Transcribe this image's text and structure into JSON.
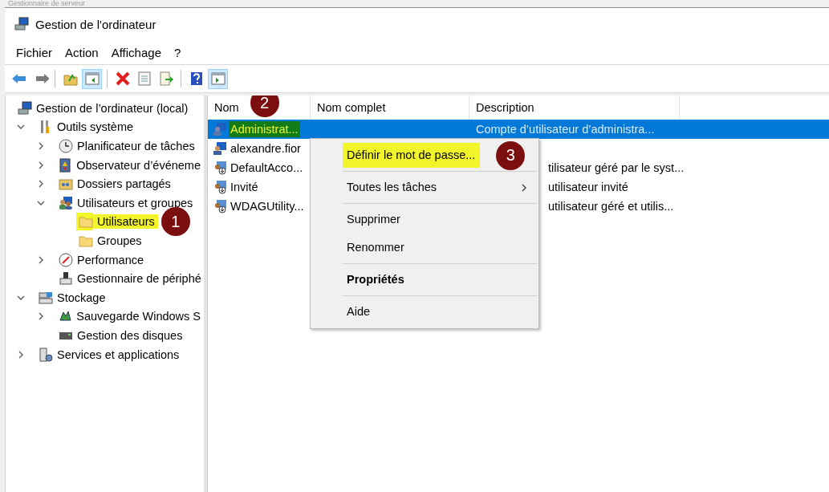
{
  "background_title": "Gestionnaire de serveur",
  "window": {
    "title": "Gestion de l'ordinateur"
  },
  "menu_bar": [
    "Fichier",
    "Action",
    "Affichage",
    "?"
  ],
  "toolbar": [
    {
      "kind": "back",
      "pressed": false
    },
    {
      "kind": "forward",
      "pressed": false
    },
    {
      "kind": "separator"
    },
    {
      "kind": "up",
      "pressed": false
    },
    {
      "kind": "tree",
      "pressed": true
    },
    {
      "kind": "separator"
    },
    {
      "kind": "delete",
      "pressed": false
    },
    {
      "kind": "properties",
      "pressed": false
    },
    {
      "kind": "export",
      "pressed": false
    },
    {
      "kind": "separator"
    },
    {
      "kind": "help",
      "pressed": false
    },
    {
      "kind": "actionpane",
      "pressed": true
    }
  ],
  "tree": [
    {
      "label": "Gestion de l’ordinateur (local)",
      "kind": "computer",
      "highlighted": false,
      "children": [
        {
          "label": "Outils système",
          "kind": "tools",
          "expanded": true,
          "highlighted": false,
          "children": [
            {
              "label": "Planificateur de tâches",
              "kind": "clock",
              "expanded": false,
              "highlighted": false
            },
            {
              "label": "Observateur d’événeme",
              "kind": "log",
              "expanded": false,
              "highlighted": false
            },
            {
              "label": "Dossiers partagés",
              "kind": "share",
              "expanded": false,
              "highlighted": false
            },
            {
              "label": "Utilisateurs et groupes",
              "kind": "users",
              "expanded": true,
              "highlighted": false,
              "children": [
                {
                  "label": "Utilisateurs",
                  "kind": "folder",
                  "highlighted": true,
                  "badge": "1"
                },
                {
                  "label": "Groupes",
                  "kind": "folder",
                  "highlighted": false
                }
              ]
            },
            {
              "label": "Performance",
              "kind": "gauge",
              "expanded": false,
              "highlighted": false
            },
            {
              "label": "Gestionnaire de périphé",
              "kind": "device",
              "highlighted": false
            }
          ]
        },
        {
          "label": "Stockage",
          "kind": "storage",
          "expanded": true,
          "highlighted": false,
          "children": [
            {
              "label": "Sauvegarde Windows S",
              "kind": "backup",
              "expanded": false,
              "highlighted": false
            },
            {
              "label": "Gestion des disques",
              "kind": "disk",
              "highlighted": false
            }
          ]
        },
        {
          "label": "Services et applications",
          "kind": "services",
          "expanded": false,
          "highlighted": false
        }
      ]
    }
  ],
  "table": {
    "columns": [
      {
        "label": "Nom",
        "badge": "2"
      },
      {
        "label": "Nom complet"
      },
      {
        "label": "Description"
      }
    ],
    "rows": [
      {
        "name": "Administrat...",
        "description": "Compte d’utilisateur d’administra...",
        "selected": true,
        "highlighted": true,
        "covered": false,
        "kind": "admin"
      },
      {
        "name": "alexandre.fior",
        "selected": false,
        "highlighted": false,
        "kind": "user"
      },
      {
        "name": "DefaultAcco...",
        "description": "tilisateur géré par le syst...",
        "selected": false,
        "highlighted": false,
        "covered": true,
        "kind": "disabled"
      },
      {
        "name": "Invité",
        "description": "utilisateur invité",
        "selected": false,
        "highlighted": false,
        "covered": true,
        "kind": "disabled"
      },
      {
        "name": "WDAGUtility...",
        "description": "utilisateur géré et utilis...",
        "selected": false,
        "highlighted": false,
        "covered": true,
        "kind": "disabled"
      }
    ]
  },
  "context_menu": [
    {
      "kind": "item",
      "label": "Définir le mot de passe...",
      "highlighted": true,
      "badge": "3"
    },
    {
      "kind": "separator"
    },
    {
      "kind": "submenu",
      "label": "Toutes les tâches",
      "highlighted": false
    },
    {
      "kind": "separator"
    },
    {
      "kind": "item",
      "label": "Supprimer",
      "highlighted": false
    },
    {
      "kind": "item",
      "label": "Renommer",
      "highlighted": false
    },
    {
      "kind": "separator"
    },
    {
      "kind": "default",
      "label": "Propriétés",
      "highlighted": false
    },
    {
      "kind": "separator"
    },
    {
      "kind": "item",
      "label": "Aide",
      "highlighted": false
    }
  ]
}
